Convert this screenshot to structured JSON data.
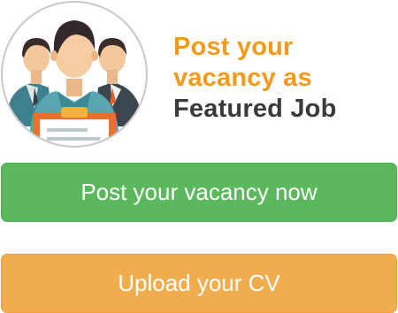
{
  "hero": {
    "image_icon": "job-seekers-clipboard-illustration",
    "headline_line1": "Post your",
    "headline_line2": "vacancy as",
    "headline_line3": "Featured Job"
  },
  "actions": {
    "post_vacancy_label": "Post your vacancy now",
    "upload_cv_label": "Upload your CV"
  },
  "colors": {
    "accent_orange": "#f39a1d",
    "text_dark": "#3a3a3a",
    "button_green": "#5cb85c",
    "button_orange": "#f0ad4e"
  }
}
